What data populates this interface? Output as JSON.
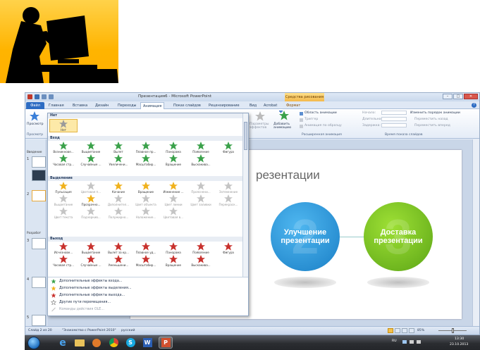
{
  "window": {
    "title": "Презентация6 - Microsoft PowerPoint",
    "context_tab": "Средства рисования"
  },
  "window_buttons": [
    "–",
    "□",
    "✕"
  ],
  "tabs": [
    {
      "label": "Файл"
    },
    {
      "label": "Главная"
    },
    {
      "label": "Вставка"
    },
    {
      "label": "Дизайн"
    },
    {
      "label": "Переходы"
    },
    {
      "label": "Анимация"
    },
    {
      "label": "Показ слайдов"
    },
    {
      "label": "Рецензирование"
    },
    {
      "label": "Вид"
    },
    {
      "label": "Acrobat"
    },
    {
      "label": "Формат"
    }
  ],
  "ribbon": {
    "preview_label": "Просмотр",
    "preview_group": "Просмотр",
    "effect_params": "Параметры эффектов",
    "add_animation": "Добавить анимацию",
    "animation_area": "Область анимации",
    "trigger": "Триггер",
    "painter": "Анимация по образцу",
    "advanced_group": "Расширенная анимация",
    "start": "Начало:",
    "duration": "Длительность:",
    "delay": "Задержка:",
    "timing_group": "Время показа слайдов",
    "reorder": "Изменить порядок анимации",
    "move_earlier": "Переместить назад",
    "move_later": "Переместить вперед"
  },
  "left_panel": {
    "section1": "Введение",
    "section2": "Разработ",
    "slide_numbers": [
      "1",
      "2",
      "3",
      "4",
      "5"
    ]
  },
  "slide": {
    "title": "резентации",
    "circles": [
      {
        "label": "Улучшение\nпрезентации",
        "digit": "2"
      },
      {
        "label": "Доставка\nпрезентации",
        "digit": "3"
      }
    ]
  },
  "gallery": {
    "none_section": "Нет",
    "none_item": "Нет",
    "entrance_section": "Вход",
    "entrance": [
      "Возникнове...",
      "Выцветание",
      "Вылет",
      "Плавное пр...",
      "Панорама",
      "Появление",
      "Фигура",
      "Часовая стр...",
      "Случайные ...",
      "Увеличени...",
      "Масштабир...",
      "Вращение",
      "Выскакива..."
    ],
    "emphasis_section": "Выделение",
    "emphasis": [
      "Пульсация",
      "Цветовая п...",
      "Качание",
      "Вращение",
      "Изменение ...",
      "Прояснени...",
      "Затемнение",
      "Выцветание",
      "Прозрачно...",
      "Дополнител...",
      "Цвет объекта",
      "Цвет линии",
      "Цвет заливки",
      "Перекраск...",
      "Цвет текста",
      "Подчеркив...",
      "Полужирно...",
      "Наложение...",
      "Цветовая в..."
    ],
    "exit_section": "Выход",
    "exit": [
      "Исчезнове...",
      "Выцветание",
      "Вылет за кр...",
      "Плавное уд...",
      "Панорама",
      "Появление",
      "Фигура",
      "Часовая стр...",
      "Случайные ...",
      "Уменьшени...",
      "Масштабир...",
      "Вращение",
      "Выскакива..."
    ],
    "links": [
      "Дополнительные эффекты входа...",
      "Дополнительные эффекты выделения...",
      "Дополнительные эффекты выхода...",
      "Другие пути перемещения...",
      "Команды действия OLE..."
    ]
  },
  "status": {
    "slide_info": "Слайд 2 из 20",
    "theme": "\"Знакомство с PowerPoint 2010\"",
    "language": "русский",
    "zoom": "85%"
  },
  "taskbar": {
    "lang": "RU",
    "time": "13:30",
    "date": "23.10.2013"
  },
  "colors": {
    "accent": "#2d6cc3",
    "entrance_star": "#3aa14a",
    "emphasis_star": "#f0b21d",
    "exit_star": "#c8312d",
    "circle_blue": "#2a95dd",
    "circle_green": "#74be1f"
  }
}
